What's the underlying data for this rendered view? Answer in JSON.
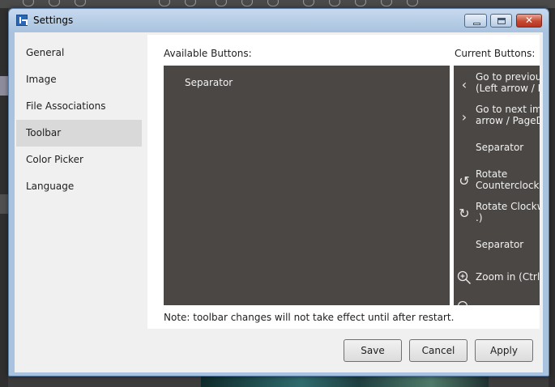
{
  "window": {
    "title": "Settings",
    "minimize_icon": "minimize-icon",
    "maximize_icon": "maximize-icon",
    "close_glyph": "✕"
  },
  "sidebar": {
    "items": [
      {
        "label": "General",
        "selected": false
      },
      {
        "label": "Image",
        "selected": false
      },
      {
        "label": "File Associations",
        "selected": false
      },
      {
        "label": "Toolbar",
        "selected": true
      },
      {
        "label": "Color Picker",
        "selected": false
      },
      {
        "label": "Language",
        "selected": false
      }
    ]
  },
  "toolbar_page": {
    "available_label": "Available Buttons:",
    "current_label": "Current Buttons:",
    "available_buttons": [
      {
        "label": "Separator"
      }
    ],
    "current_buttons": [
      {
        "icon": "chevron-left-icon",
        "label": "Go to previous\n(Left arrow / Pa"
      },
      {
        "icon": "chevron-right-icon",
        "label": "Go to next ima\narrow / PageDo"
      },
      {
        "icon": "",
        "label": "Separator"
      },
      {
        "icon": "rotate-ccw-icon",
        "label": "Rotate\nCounterclockw"
      },
      {
        "icon": "rotate-cw-icon",
        "label": "Rotate Clockwi\n.)"
      },
      {
        "icon": "",
        "label": "Separator"
      },
      {
        "icon": "zoom-in-icon",
        "label": "Zoom in (Ctrl +"
      }
    ],
    "note": "Note: toolbar changes will not take effect until after restart."
  },
  "buttons": {
    "save": "Save",
    "cancel": "Cancel",
    "apply": "Apply"
  },
  "colors": {
    "list_background": "#4a4745",
    "selected_nav": "#d9d9d9",
    "title_bar": "#a9c3df"
  }
}
